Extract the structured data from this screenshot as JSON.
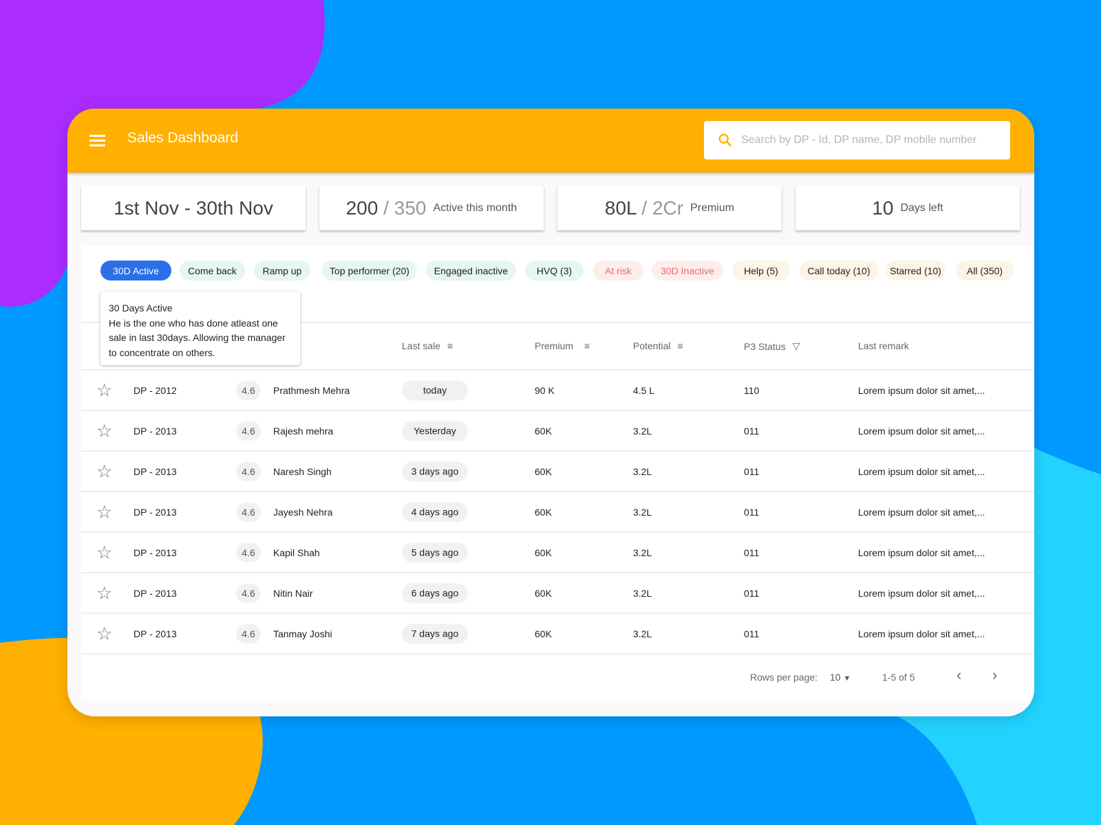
{
  "appbar": {
    "title": "Sales Dashboard",
    "search_placeholder": "Search by DP - Id, DP name, DP mobile number"
  },
  "stats": [
    {
      "main": "1st Nov - 30th Nov"
    },
    {
      "value": "200",
      "sep": " / ",
      "total": "350",
      "label": "Active this month"
    },
    {
      "value": "80L",
      "sep": " / ",
      "total": "2Cr",
      "label": "Premium"
    },
    {
      "value": "10",
      "label": "Days left"
    }
  ],
  "chips": [
    {
      "label": "30D Active",
      "tone": "active"
    },
    {
      "label": "Come back",
      "tone": "green"
    },
    {
      "label": "Ramp up",
      "tone": "green"
    },
    {
      "label": "Top performer (20)",
      "tone": "green"
    },
    {
      "label": "Engaged inactive",
      "tone": "green"
    },
    {
      "label": "HVQ (3)",
      "tone": "green"
    },
    {
      "label": "At risk",
      "tone": "red"
    },
    {
      "label": "30D Inactive",
      "tone": "red"
    },
    {
      "label": "Help (5)",
      "tone": "orange"
    },
    {
      "label": "Call today (10)",
      "tone": "orange"
    },
    {
      "label": "Starred (10)",
      "tone": "orange"
    },
    {
      "label": "All (350)",
      "tone": "orange"
    }
  ],
  "tooltip": {
    "title": "30 Days Active",
    "body": "He is the one who has done atleast one sale in last 30days. Allowing the manager to concentrate on others."
  },
  "table": {
    "headers": {
      "last_sale": "Last sale",
      "premium": "Premium",
      "potential": "Potential",
      "p3": "P3 Status",
      "remark": "Last remark"
    },
    "rows": [
      {
        "id": "DP - 2012",
        "rating": "4.6",
        "name": "Prathmesh Mehra",
        "last_sale": "today",
        "premium": "90 K",
        "potential": "4.5 L",
        "p3": "110",
        "remark": "Lorem ipsum dolor sit amet,..."
      },
      {
        "id": "DP - 2013",
        "rating": "4.6",
        "name": "Rajesh mehra",
        "last_sale": "Yesterday",
        "premium": "60K",
        "potential": "3.2L",
        "p3": "011",
        "remark": "Lorem ipsum dolor sit amet,..."
      },
      {
        "id": "DP - 2013",
        "rating": "4.6",
        "name": "Naresh Singh",
        "last_sale": "3 days ago",
        "premium": "60K",
        "potential": "3.2L",
        "p3": "011",
        "remark": "Lorem ipsum dolor sit amet,..."
      },
      {
        "id": "DP - 2013",
        "rating": "4.6",
        "name": "Jayesh Nehra",
        "last_sale": "4 days ago",
        "premium": "60K",
        "potential": "3.2L",
        "p3": "011",
        "remark": "Lorem ipsum dolor sit amet,..."
      },
      {
        "id": "DP - 2013",
        "rating": "4.6",
        "name": "Kapil Shah",
        "last_sale": "5 days ago",
        "premium": "60K",
        "potential": "3.2L",
        "p3": "011",
        "remark": "Lorem ipsum dolor sit amet,..."
      },
      {
        "id": "DP - 2013",
        "rating": "4.6",
        "name": "Nitin Nair",
        "last_sale": "6 days ago",
        "premium": "60K",
        "potential": "3.2L",
        "p3": "011",
        "remark": "Lorem ipsum dolor sit amet,..."
      },
      {
        "id": "DP - 2013",
        "rating": "4.6",
        "name": "Tanmay Joshi",
        "last_sale": "7 days ago",
        "premium": "60K",
        "potential": "3.2L",
        "p3": "011",
        "remark": "Lorem ipsum dolor sit amet,..."
      }
    ]
  },
  "pagination": {
    "rows_label": "Rows per page:",
    "rows_value": "10",
    "range": "1-5 of 5"
  },
  "colors": {
    "appbar": "#ffb000",
    "active_chip": "#2a6fe8",
    "background": "#0099ff"
  }
}
